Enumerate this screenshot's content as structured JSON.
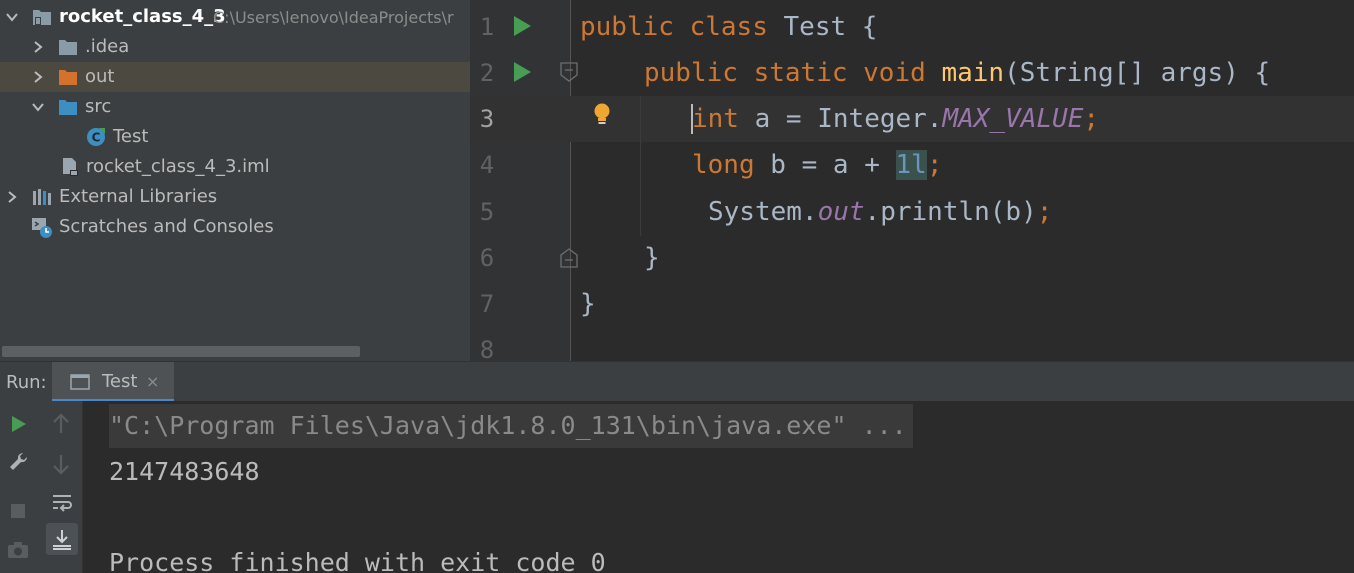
{
  "project_tree": {
    "root": {
      "name": "rocket_class_4_3",
      "path": "C:\\Users\\lenovo\\IdeaProjects\\r"
    },
    "items": [
      {
        "label": ".idea",
        "icon": "folder-icon"
      },
      {
        "label": "out",
        "icon": "folder-orange-icon"
      },
      {
        "label": "src",
        "icon": "folder-source-icon"
      },
      {
        "label": "Test",
        "icon": "java-class-icon"
      },
      {
        "label": "rocket_class_4_3.iml",
        "icon": "iml-file-icon"
      },
      {
        "label": "External Libraries",
        "icon": "libraries-icon"
      },
      {
        "label": "Scratches and Consoles",
        "icon": "scratches-icon"
      }
    ]
  },
  "editor": {
    "line_numbers": [
      "1",
      "2",
      "3",
      "4",
      "5",
      "6",
      "7",
      "8"
    ],
    "lines": {
      "l1": {
        "kw1": "public",
        "kw2": "class",
        "rest": " Test {"
      },
      "l2": {
        "kw1": "public",
        "kw2": "static",
        "kw3": "void",
        "fn": "main",
        "rest": "(String[] args) {"
      },
      "l3": {
        "kw": "int",
        "mid": " a = Integer.",
        "const": "MAX_VALUE",
        "semi": ";"
      },
      "l4": {
        "kw": "long",
        "mid": " b = a + ",
        "num": "1l",
        "semi": ";"
      },
      "l5": {
        "pre": "System.",
        "field": "out",
        "post": ".println(b)",
        "semi": ";"
      },
      "l6": {
        "text": "}"
      },
      "l7": {
        "text": "}"
      }
    }
  },
  "run_panel": {
    "label": "Run:",
    "tab_label": "Test",
    "tab_close": "×",
    "console": {
      "command": "\"C:\\Program Files\\Java\\jdk1.8.0_131\\bin\\java.exe\" ...",
      "output": "2147483648",
      "exit": "Process finished with exit code 0"
    }
  },
  "colors": {
    "keyword": "#cc7832",
    "method": "#ffc66d",
    "constant": "#9876aa",
    "number": "#6897bb",
    "run_green": "#499c54"
  }
}
